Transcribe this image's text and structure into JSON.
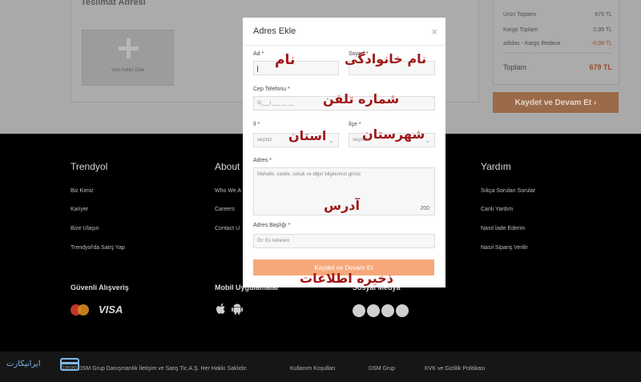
{
  "address_card": {
    "title": "Teslimat Adresi",
    "new_address_label": "Yeni Adres Ekle"
  },
  "summary": {
    "rows": [
      {
        "label": "Ürün Toplamı",
        "value": "679 TL"
      },
      {
        "label": "Kargo Toplam",
        "value": "0,99 TL"
      },
      {
        "label": "adidas - Kargo Bedava",
        "value": "-0,99 TL"
      }
    ],
    "total_label": "Toplam",
    "total_value": "679 TL",
    "save_button": "Kaydet ve Devam Et"
  },
  "modal": {
    "title": "Adres Ekle",
    "close": "×",
    "name_label": "Ad *",
    "surname_label": "Soyad *",
    "phone_label": "Cep Telefonu *",
    "phone_placeholder": "0(___) ___ __ __",
    "city_label": "İl *",
    "city_value": "seçiniz",
    "district_label": "İlçe *",
    "district_value": "seçiniz",
    "address_label": "Adres *",
    "address_placeholder": "Mahalle, cadde, sokak ve diğer bilgilerinizi giriniz",
    "address_counter": "200",
    "title_label": "Adres Başlığı *",
    "title_placeholder": "Ör: Ev Adresim",
    "submit": "Kaydet ve Devam Et"
  },
  "annotations": {
    "name": "نام",
    "surname": "نام خانوادگی",
    "phone": "شماره تلفن",
    "city": "استان",
    "district": "شهرستان",
    "address": "آدرس",
    "save": "ذخیره اطلاعات"
  },
  "footer": {
    "columns": [
      {
        "title": "Trendyol",
        "links": [
          "Biz Kimiz",
          "Kariyer",
          "Bize Ulaşın",
          "Trendyol'da Satış Yap"
        ]
      },
      {
        "title": "About",
        "links": [
          "Who We A",
          "Careers",
          "Contact U"
        ]
      },
      {
        "title": "Yardım",
        "links": [
          "Sıkça Sorulan Sorular",
          "Canlı Yardım",
          "Nasıl İade Ederim",
          "Nasıl Sipariş Verilir"
        ]
      }
    ],
    "secure_title": "Güvenli Alışveriş",
    "visa": "VISA",
    "mobile_title": "Mobil Uygulamalar",
    "social_title": "Sosyal Medya",
    "bottom_links": [
      "©2020 DSM Grup Danışmanlık İletişim ve Satış Tic.A.Ş. Her Hakkı Saklıdır.",
      "Kullanım Koşulları",
      "DSM Grup",
      "KVK ve Gizlilik Politikası"
    ],
    "logo_text": "ایرانیکارت"
  }
}
